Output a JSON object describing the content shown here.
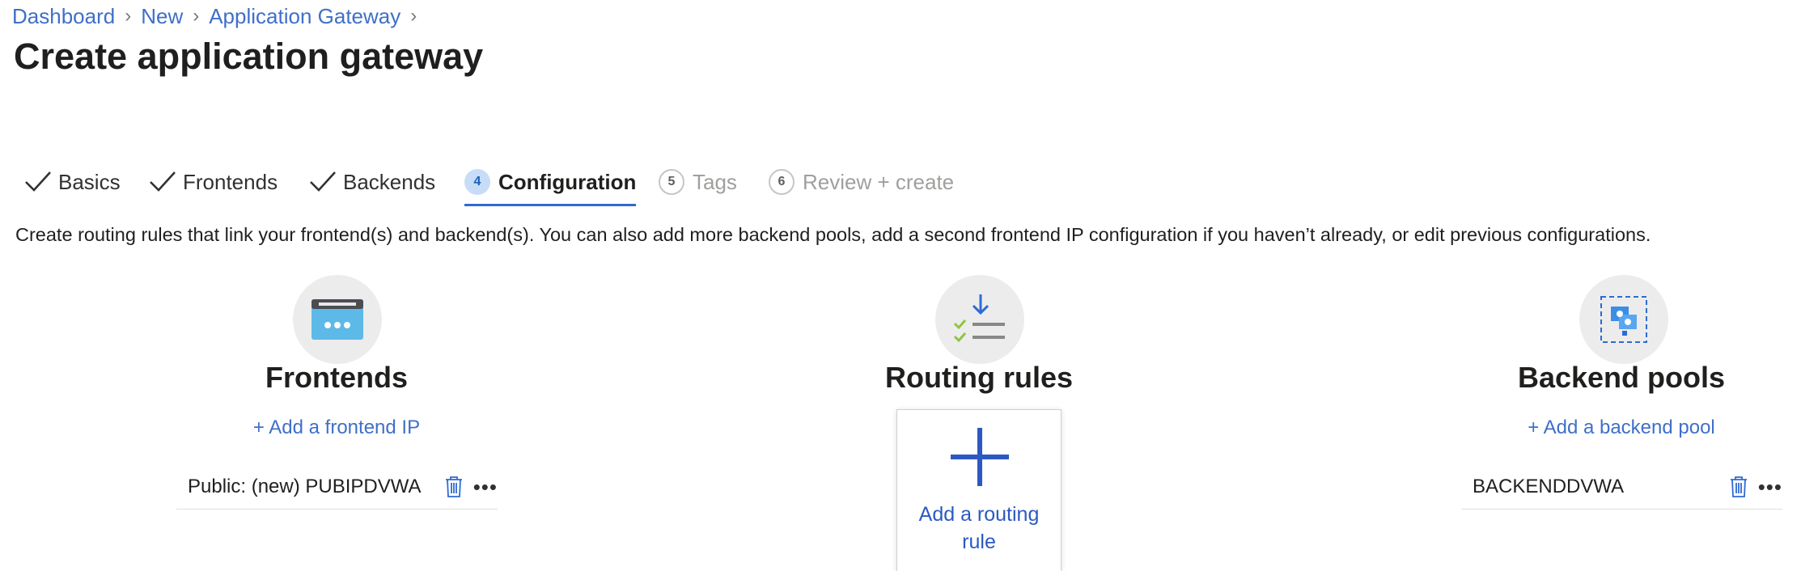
{
  "breadcrumb": [
    {
      "label": "Dashboard"
    },
    {
      "label": "New"
    },
    {
      "label": "Application Gateway"
    }
  ],
  "title": "Create application gateway",
  "tabs": [
    {
      "label": "Basics",
      "state": "completed"
    },
    {
      "label": "Frontends",
      "state": "completed"
    },
    {
      "label": "Backends",
      "state": "completed"
    },
    {
      "label": "Configuration",
      "state": "active",
      "step": "4"
    },
    {
      "label": "Tags",
      "state": "disabled",
      "step": "5"
    },
    {
      "label": "Review + create",
      "state": "disabled",
      "step": "6"
    }
  ],
  "description": "Create routing rules that link your frontend(s) and backend(s). You can also add more backend pools, add a second frontend IP configuration if you haven’t already, or edit previous configurations.",
  "frontends": {
    "title": "Frontends",
    "add_link": "+ Add a frontend IP",
    "items": [
      {
        "label": "Public: (new) PUBIPDVWA"
      }
    ],
    "icon": "frontend-window-icon"
  },
  "routing": {
    "title": "Routing rules",
    "add_card_label": "Add a routing rule",
    "icon": "routing-rules-icon"
  },
  "backends": {
    "title": "Backend pools",
    "add_link": "+ Add a backend pool",
    "items": [
      {
        "label": "BACKENDDVWA"
      }
    ],
    "icon": "backend-pool-icon"
  },
  "icons": {
    "trash": "trash-icon",
    "more": "more-icon"
  },
  "colors": {
    "link": "#3f6fc9",
    "accent": "#2f6ad3",
    "active_step_bg": "#c7dcf7",
    "disabled_text": "#a19f9d"
  }
}
